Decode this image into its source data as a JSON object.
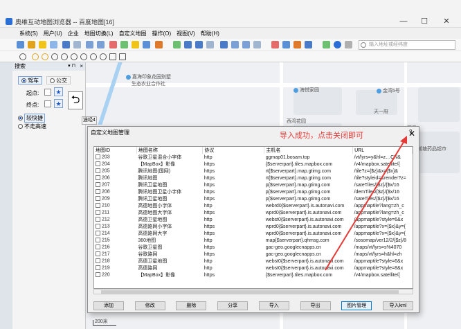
{
  "window": {
    "title": "奥维互动地图浏览器 -- 百度地图[16]",
    "min": "—",
    "max": "☐",
    "close": "✕"
  },
  "menu": [
    "系统(S)",
    "用户(U)",
    "企业",
    "地图切换(L)",
    "自定义地图",
    "操作(O)",
    "视图(V)",
    "帮助(H)"
  ],
  "search": {
    "placeholder": "输入地址或经纬度"
  },
  "left_panel": {
    "title": "搜索",
    "pin": "▾ ⊓",
    "close": "×",
    "tabs": [
      "驾车",
      "公交"
    ],
    "start_label": "起点:",
    "end_label": "终点:",
    "options": [
      "较快捷",
      "不走高速"
    ],
    "side_tab": "途经4"
  },
  "map": {
    "pois": [
      "嘉海印象花园别墅",
      "生态农业合作社",
      "海悦家园",
      "金湾5号",
      "西湾花园",
      "天一府",
      "四季",
      "湖塘药品超市"
    ],
    "scale": "200米"
  },
  "dialog": {
    "title": "自定义地图管理",
    "help": "?",
    "close": "✕",
    "annotation": "导入成功，点击关闭即可",
    "columns": [
      "地图ID",
      "地图名称",
      "协议",
      "主机名",
      "URL"
    ],
    "rows": [
      [
        "203",
        "谷歌卫星混合小字体",
        "http",
        "ggmap01.bosam.top",
        "/vt/lyrs=y&hl=z…CN&"
      ],
      [
        "204",
        "【MapBox】影像",
        "https",
        "{$serverpart}.tiles.mapbox.com",
        "/v4/mapbox.satellite/{"
      ],
      [
        "205",
        "腾讯地图(国网)",
        "https",
        "rt{$serverpart}.map.gtimg.com",
        "/tile?z={$z}&x={$x}&"
      ],
      [
        "206",
        "腾讯地图",
        "https",
        "rt{$serverpart}.map.gtimg.com",
        "/tile?styleid=&render?z="
      ],
      [
        "207",
        "腾讯卫星地图",
        "https",
        "p{$serverpart}.map.gtimg.com",
        "/sateTiles/{$z}/{$x/16"
      ],
      [
        "208",
        "腾讯地图卫星小字体",
        "https",
        "p{$serverpart}.map.gtimg.com",
        "/demTiles/{$z}/{$x/16"
      ],
      [
        "209",
        "腾讯卫星地图",
        "https",
        "p{$serverpart}.map.gtimg.com",
        "/sateTiles/{$z}/{$x/16"
      ],
      [
        "210",
        "高德地图小字体",
        "http",
        "webrd0{$serverpart}.is.autonavi.com",
        "/appmaptile?lang=zh_c"
      ],
      [
        "211",
        "高德地图大字体",
        "https",
        "wprd0{$serverpart}.is.autonavi.com",
        "/appmaptile?lang=zh_c"
      ],
      [
        "212",
        "高德卫星地图",
        "http",
        "webst0{$serverpart}.is.autonavi.com",
        "/appmaptile?style=6&x"
      ],
      [
        "213",
        "高德路网小字体",
        "https",
        "wprd0{$serverpart}.is.autonavi.com",
        "/appmaptile?x={$x}&y={"
      ],
      [
        "214",
        "高德路网大字",
        "https",
        "wprd0{$serverpart}.is.autonavi.com",
        "/appmaptile?x={$x}&y={"
      ],
      [
        "215",
        "360地图",
        "http",
        "map{$serverpart}.qhmsg.com",
        "/sosomap/ver12/2/{$z}/8"
      ],
      [
        "216",
        "谷歌卫星图",
        "https",
        "gac-geo.googlecnapps.cn",
        "/maps/vt/lyrs=s%4070"
      ],
      [
        "217",
        "谷歌路网",
        "https",
        "gac-geo.googlecnapps.cn",
        "/maps/vt/lyrs=h&hl=zh"
      ],
      [
        "218",
        "高德卫星地图",
        "http",
        "webst0{$serverpart}.is.autonavi.com",
        "/appmaptile?style=6&x"
      ],
      [
        "219",
        "高德路网",
        "http",
        "webst0{$serverpart}.is.autonavi.com",
        "/appmaptile?style=8&x"
      ],
      [
        "220",
        "【MapBox】影像",
        "https",
        "{$serverpart}.tiles.mapbox.com",
        "/v4/mapbox.satellite/{"
      ]
    ],
    "buttons": [
      "添加",
      "修改",
      "删除",
      "分享",
      "导入",
      "导出",
      "图片管理",
      "导入kml"
    ]
  }
}
